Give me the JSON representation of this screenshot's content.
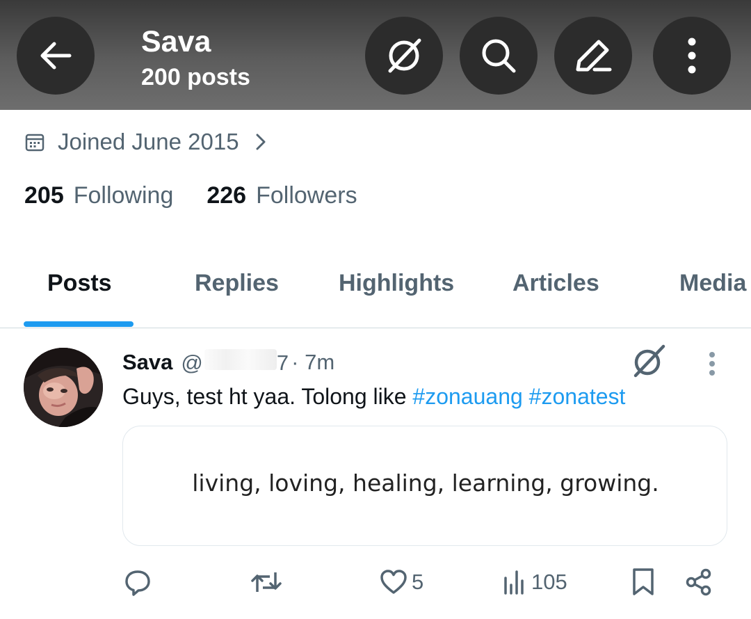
{
  "header": {
    "name": "Sava",
    "post_count": "200 posts",
    "icons": [
      "back-arrow-icon",
      "grok-icon",
      "search-icon",
      "edit-icon",
      "more-vertical-icon"
    ]
  },
  "profile": {
    "joined": "Joined June 2015",
    "following_count": "205",
    "following_label": "Following",
    "followers_count": "226",
    "followers_label": "Followers"
  },
  "tabs": [
    {
      "label": "Posts",
      "active": true
    },
    {
      "label": "Replies",
      "active": false
    },
    {
      "label": "Highlights",
      "active": false
    },
    {
      "label": "Articles",
      "active": false
    },
    {
      "label": "Media",
      "active": false
    }
  ],
  "post": {
    "author_name": "Sava",
    "handle_prefix": "@",
    "handle_suffix": "7",
    "time": "· 7m",
    "text_plain": "Guys, test ht yaa. Tolong like",
    "hashtags": [
      "#zonauang",
      "#zonatest"
    ],
    "card_text": "living, loving, healing, learning, growing.",
    "actions": {
      "reply_count": "",
      "repost_count": "",
      "like_count": "5",
      "views_count": "105"
    }
  },
  "colors": {
    "accent": "#1d9bf0",
    "secondary_text": "#536471",
    "primary_text": "#0f1419",
    "header_button": "#2c2c2c"
  }
}
